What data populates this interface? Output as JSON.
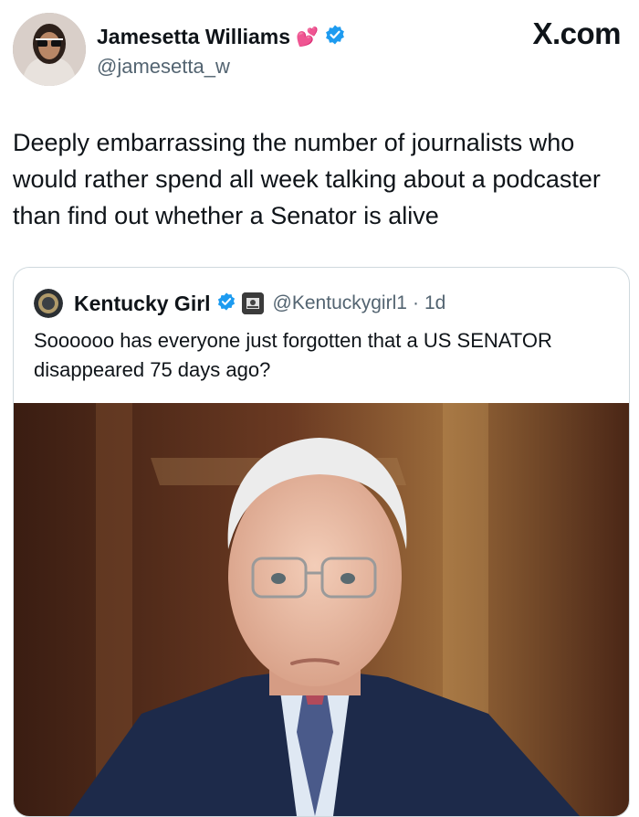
{
  "post": {
    "author": {
      "display_name": "Jamesetta Williams",
      "emoji": "💕",
      "handle": "@jamesetta_w",
      "verified": true
    },
    "brand": "X.com",
    "text": "Deeply embarrassing the number of journalists who would rather spend all week talking about a podcaster than find out whether a Senator is alive"
  },
  "quote": {
    "author": {
      "display_name": "Kentucky Girl",
      "handle": "@Kentuckygirl1",
      "separator": "·",
      "time": "1d",
      "verified": true
    },
    "text": "Soooooo has everyone just forgotten that a US SENATOR disappeared 75 days ago?"
  },
  "colors": {
    "verified_blue": "#1d9bf0",
    "secondary_text": "#536471",
    "border": "#cfd9de"
  },
  "icons": {
    "verified": "verified-badge-icon",
    "brand": "x-logo"
  }
}
